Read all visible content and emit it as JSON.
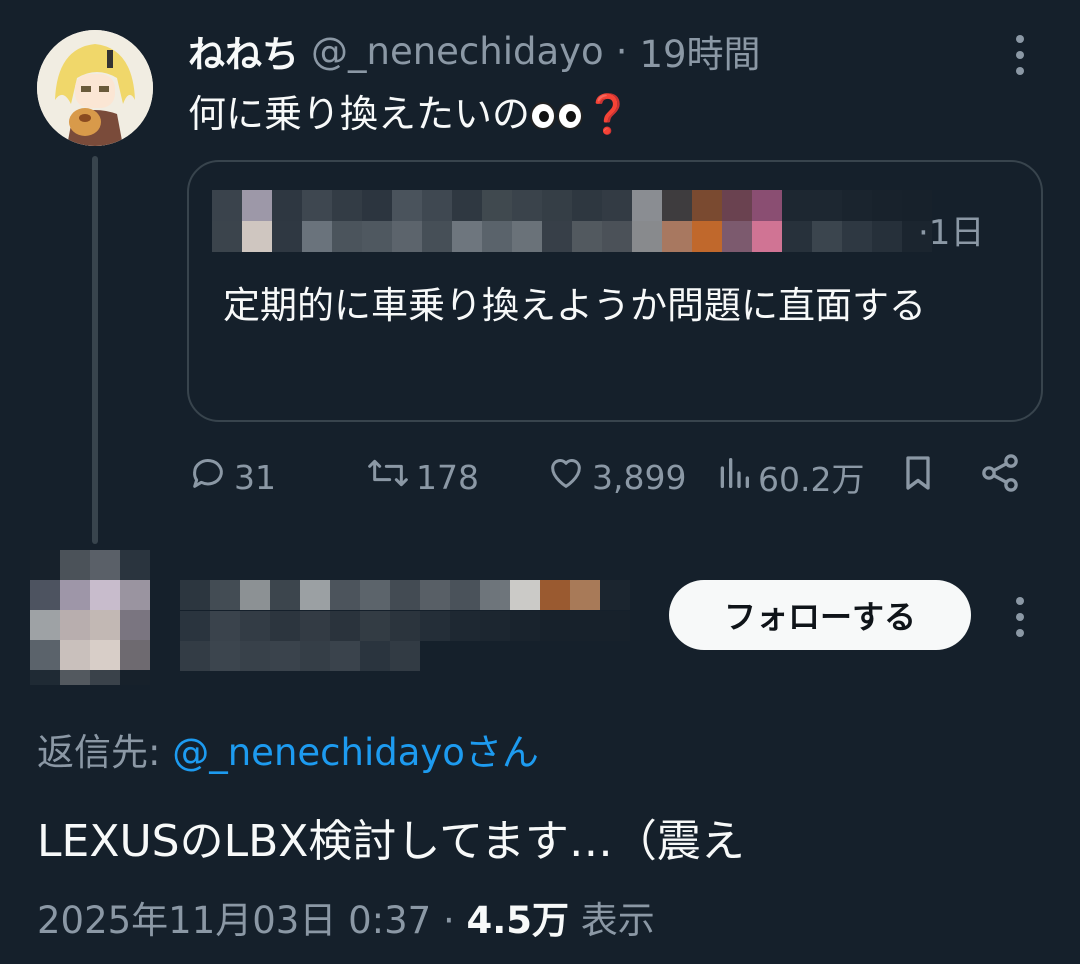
{
  "tweet": {
    "display_name": "ねねち",
    "handle": "@_nenechidayo",
    "separator": "·",
    "time": "19時間",
    "text": "何に乗り換えたいの",
    "emoji": "❓"
  },
  "quote": {
    "time": "·1日",
    "text": "定期的に車乗り換えようか問題に直面する"
  },
  "actions": {
    "replies": "31",
    "retweets": "178",
    "likes": "3,899",
    "views": "60.2万"
  },
  "reply": {
    "follow_label": "フォローする",
    "reply_to_prefix": "返信先: ",
    "reply_to_handle": "@_nenechidayo",
    "reply_to_suffix": "さん",
    "text": "LEXUSのLBX検討してます…（震え",
    "timestamp": "2025年11月03日 0:37",
    "dot": "·",
    "view_count": "4.5万",
    "view_label": "表示"
  },
  "colors": {
    "background": "#15202b",
    "text": "#f7f9f9",
    "secondary": "#8b98a5",
    "link": "#1d9bf0",
    "border": "#38444d"
  }
}
